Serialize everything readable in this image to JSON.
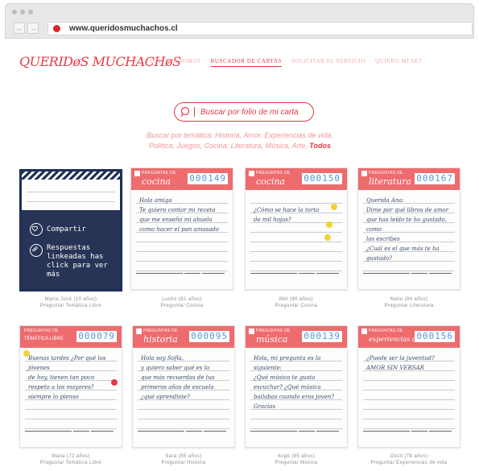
{
  "browser": {
    "url": "www.queridosmuchachos.cl"
  },
  "site": {
    "logo": "QUERIDøS MUCHACHøS",
    "nav": [
      "QUIENES SOMOS",
      "BUSCADOR DE CARTAS",
      "SOLICITAR EL SERVICIO",
      "QUIERO MI SET"
    ],
    "active_nav": "BUSCADOR DE CARTAS"
  },
  "search": {
    "placeholder": "Buscar por folio de mi carta"
  },
  "themes": {
    "prefix": "Buscar por temática: Historia, Amor, Experiencias de vida,",
    "line2": "Política, Juegos, Cocina, Literatura, Música, Arte,",
    "all": "Todos"
  },
  "overlay": {
    "share": "Compartir",
    "linked": "Respuestas linkeadas has click para ver más"
  },
  "cards": [
    {
      "folio": "",
      "header": "",
      "theme": "",
      "caption1": "Marta José (10 años)",
      "caption2": "Pregunta/ Temática Libre",
      "text": ""
    },
    {
      "folio": "000149",
      "header": "PREGUNTAS DE",
      "theme": "cocina",
      "caption1": "Lucho (82 años)",
      "caption2": "Pregunta/ Cocina",
      "text": "Hola amiga\nTe quiero contar mi receta\nque me enseñó mi abuela\ncomo hacer el pan amasado"
    },
    {
      "folio": "000150",
      "header": "PREGUNTAS DE",
      "theme": "cocina",
      "caption1": "Mel (80 años)",
      "caption2": "Pregunta/ Cocina",
      "text": "\n¿Cómo se hace la torta\nde mil hojas?"
    },
    {
      "folio": "000167",
      "header": "PREGUNTAS DE",
      "theme": "literatura",
      "caption1": "Naito (84 años)",
      "caption2": "Pregunta/ Literatura",
      "text": "Querida Ana:\nDime por qué libros de amor\nque has leído te ha gustado, como\nlos escribes\n¿Cuál es el que más te ha\ngustado?"
    },
    {
      "folio": "000079",
      "header": "PREGUNTAS DE",
      "theme": "TEMÁTICA LIBRE",
      "caption1": "Mana (72 años)",
      "caption2": "Pregunta/ Temática Libre",
      "text": "Buenas tardes ¿Por qué los jóvenes\nde hoy, tienen tan poco\nrespeto a los mayores?\nsiempre lo pienso"
    },
    {
      "folio": "000095",
      "header": "PREGUNTAS DE",
      "theme": "historia",
      "caption1": "Sara (85 años)",
      "caption2": "Pregunta/ Historia",
      "text": "Hola soy Sofía,\ny quiero saber qué es lo\nque más recuerdas de tus\nprimeros años de escuela\n¿qué aprendiste?"
    },
    {
      "folio": "000139",
      "header": "PREGUNTAS DE",
      "theme": "música",
      "caption1": "Ange (85 años)",
      "caption2": "Pregunta/ Música",
      "text": "Hola, mi pregunta es la\nsiguiente:\n¿Qué música te gusta\nescuchar? ¿Qué música\nbailabas cuando eras joven?\nGracias"
    },
    {
      "folio": "000156",
      "header": "PREGUNTAS DE",
      "theme": "experiencias de vida",
      "caption1": "Oscit (78 años)",
      "caption2": "Pregunta/ Experiencias de vida",
      "text": "¿Puede ser la juventud?\nAMOR SIN VERSAR"
    }
  ],
  "colors": {
    "brand": "#e63a45",
    "card_header": "#ee6b6e",
    "overlay": "#1f2f57"
  }
}
